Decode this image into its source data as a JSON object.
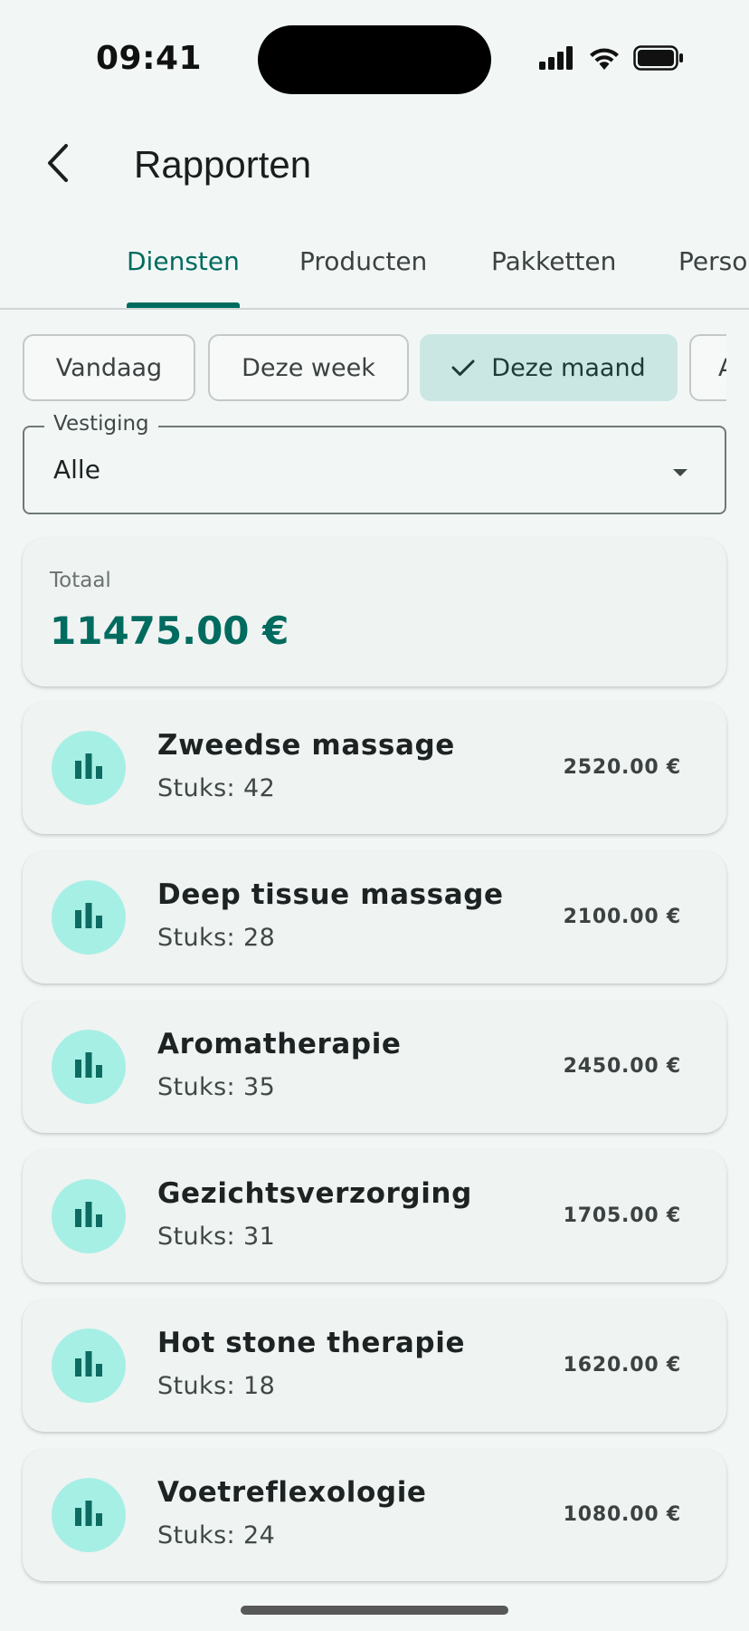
{
  "status_bar": {
    "time": "09:41"
  },
  "header": {
    "title": "Rapporten",
    "back_icon": "chevron-left-icon"
  },
  "tabs": [
    {
      "label": "Diensten",
      "active": true
    },
    {
      "label": "Producten",
      "active": false
    },
    {
      "label": "Pakketten",
      "active": false
    },
    {
      "label": "Perso",
      "active": false
    }
  ],
  "filters": {
    "chips": [
      {
        "label": "Vandaag",
        "selected": false
      },
      {
        "label": "Deze week",
        "selected": false
      },
      {
        "label": "Deze maand",
        "selected": true
      },
      {
        "label": "A",
        "selected": false
      }
    ]
  },
  "location_select": {
    "label": "Vestiging",
    "value": "Alle"
  },
  "total": {
    "label": "Totaal",
    "value": "11475.00 €"
  },
  "services": [
    {
      "name": "Zweedse massage",
      "count": "Stuks: 42",
      "amount": "2520.00 €",
      "icon": "bar-chart-icon"
    },
    {
      "name": "Deep tissue massage",
      "count": "Stuks: 28",
      "amount": "2100.00 €",
      "icon": "bar-chart-icon"
    },
    {
      "name": "Aromatherapie",
      "count": "Stuks: 35",
      "amount": "2450.00 €",
      "icon": "bar-chart-icon"
    },
    {
      "name": "Gezichtsverzorging",
      "count": "Stuks: 31",
      "amount": "1705.00 €",
      "icon": "bar-chart-icon"
    },
    {
      "name": "Hot stone therapie",
      "count": "Stuks: 18",
      "amount": "1620.00 €",
      "icon": "bar-chart-icon"
    },
    {
      "name": "Voetreflexologie",
      "count": "Stuks: 24",
      "amount": "1080.00 €",
      "icon": "bar-chart-icon"
    }
  ],
  "colors": {
    "primary": "#006b5f",
    "background": "#f2f7f6",
    "avatar": "#a6efe5",
    "chip_selected": "#cbe7e3"
  }
}
